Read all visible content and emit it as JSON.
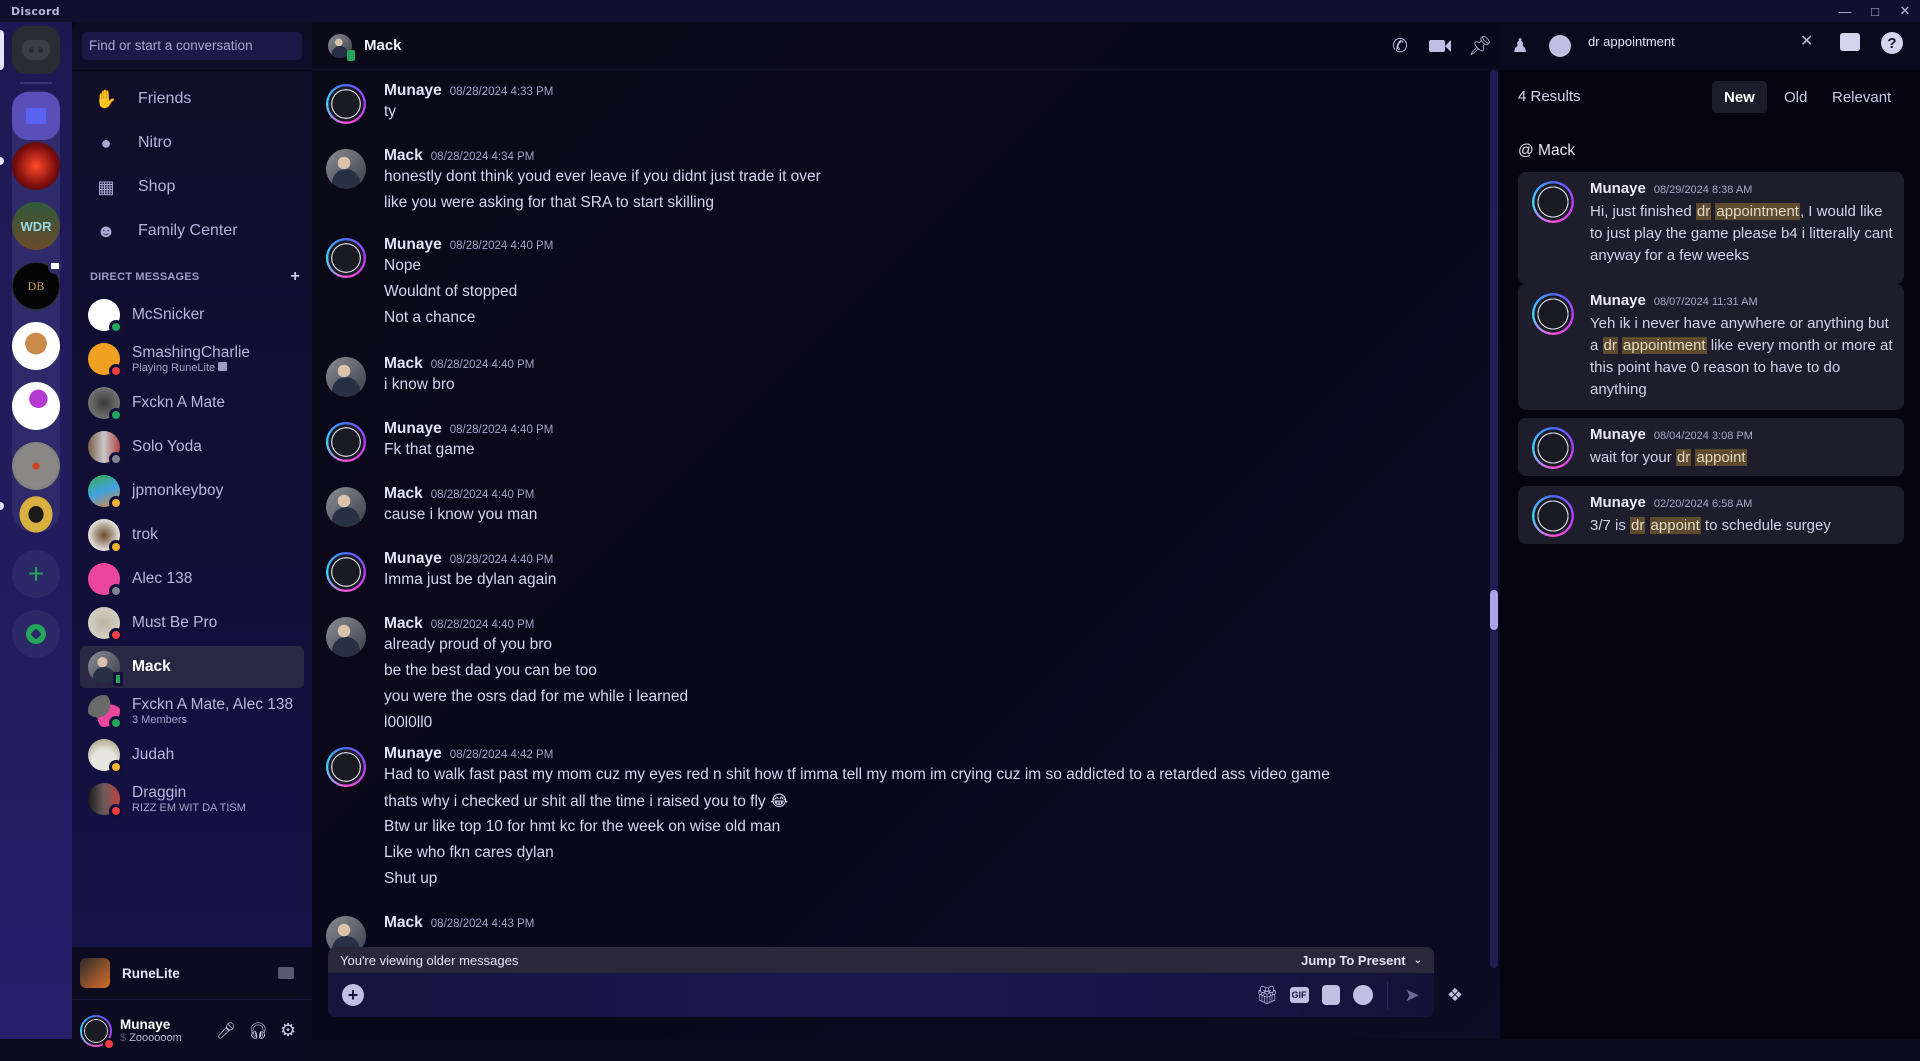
{
  "window": {
    "title": "Discord",
    "controls": [
      "minimize",
      "maximize",
      "close"
    ]
  },
  "servers": [
    {
      "name": "Direct Messages",
      "icon": "discord-logo-icon"
    },
    {
      "name": "Folder",
      "icon": "folder-icon"
    },
    {
      "name": "Server red demon",
      "icon": "server-icon"
    },
    {
      "name": "WDR",
      "icon": "server-icon",
      "label": "WDR"
    },
    {
      "name": "DB",
      "icon": "server-icon",
      "label": "DB"
    },
    {
      "name": "Doge server",
      "icon": "server-icon"
    },
    {
      "name": "Crab server",
      "icon": "server-icon"
    },
    {
      "name": "Rune server",
      "icon": "server-icon"
    },
    {
      "name": "Spartan server",
      "icon": "server-icon"
    },
    {
      "name": "Add a Server",
      "icon": "plus-icon"
    },
    {
      "name": "Discover",
      "icon": "compass-icon"
    }
  ],
  "sidebar": {
    "search_placeholder": "Find or start a conversation",
    "nav": [
      {
        "label": "Friends",
        "icon": "friends-icon"
      },
      {
        "label": "Nitro",
        "icon": "nitro-icon"
      },
      {
        "label": "Shop",
        "icon": "shop-icon"
      },
      {
        "label": "Family Center",
        "icon": "family-icon"
      }
    ],
    "dm_header": "DIRECT MESSAGES",
    "dm_add": "+",
    "dms": [
      {
        "name": "McSnicker",
        "sub": "",
        "status": "online"
      },
      {
        "name": "SmashingCharlie",
        "sub": "Playing RuneLite",
        "status": "dnd"
      },
      {
        "name": "Fxckn A Mate",
        "sub": "",
        "status": "online"
      },
      {
        "name": "Solo Yoda",
        "sub": "",
        "status": "offline"
      },
      {
        "name": "jpmonkeyboy",
        "sub": "",
        "status": "idle"
      },
      {
        "name": "trok",
        "sub": "",
        "status": "idle"
      },
      {
        "name": "Alec 138",
        "sub": "",
        "status": "offline"
      },
      {
        "name": "Must Be Pro",
        "sub": "",
        "status": "dnd"
      },
      {
        "name": "Mack",
        "sub": "",
        "status": "mobile",
        "active": true
      },
      {
        "name": "Fxckn A Mate, Alec 138",
        "sub": "3 Members",
        "status": "group"
      },
      {
        "name": "Judah",
        "sub": "",
        "status": "idle"
      },
      {
        "name": "Draggin",
        "sub": "RIZZ EM WIT DA TISM",
        "status": "dnd"
      }
    ],
    "activity": {
      "game": "RuneLite"
    },
    "user": {
      "name": "Munaye",
      "status_text": "Zoooooom"
    }
  },
  "colors": {
    "online": "#23a55a",
    "dnd": "#f23f43",
    "idle": "#f0b232",
    "offline": "#80848e",
    "accent": "#5865f2",
    "highlight": "#5e4a2c"
  },
  "chat": {
    "recipient": "Mack",
    "messages": [
      {
        "author": "Munaye",
        "timestamp": "08/28/2024 4:33 PM",
        "lines": [
          "ty"
        ]
      },
      {
        "author": "Mack",
        "timestamp": "08/28/2024 4:34 PM",
        "lines": [
          "honestly dont think youd ever leave if you didnt just trade it over",
          "like you were asking for that SRA to start skilling"
        ]
      },
      {
        "author": "Munaye",
        "timestamp": "08/28/2024 4:40 PM",
        "lines": [
          "Nope",
          "Wouldnt of stopped",
          "Not a chance"
        ]
      },
      {
        "author": "Mack",
        "timestamp": "08/28/2024 4:40 PM",
        "lines": [
          "i know bro"
        ]
      },
      {
        "author": "Munaye",
        "timestamp": "08/28/2024 4:40 PM",
        "lines": [
          "Fk that game"
        ]
      },
      {
        "author": "Mack",
        "timestamp": "08/28/2024 4:40 PM",
        "lines": [
          "cause i know you man"
        ]
      },
      {
        "author": "Munaye",
        "timestamp": "08/28/2024 4:40 PM",
        "lines": [
          "Imma just be dylan again"
        ]
      },
      {
        "author": "Mack",
        "timestamp": "08/28/2024 4:40 PM",
        "lines": [
          "already proud of you bro",
          "be the best dad you can be too",
          "you were the osrs dad for me while i learned",
          "l00l0ll0"
        ]
      },
      {
        "author": "Munaye",
        "timestamp": "08/28/2024 4:42 PM",
        "lines": [
          "Had to walk fast past my mom cuz my eyes red n shit how tf imma tell my mom im crying cuz im so addicted to a retarded ass video game",
          "thats why i checked ur shit all the time i raised you to fly 😂",
          "Btw ur like top 10 for hmt kc for the week on wise old man",
          "Like who fkn cares dylan",
          "Shut up"
        ]
      },
      {
        "author": "Mack",
        "timestamp": "08/28/2024 4:43 PM",
        "lines": []
      }
    ],
    "older_notice": "You're viewing older messages",
    "jump_label": "Jump To Present",
    "composer_placeholder": ""
  },
  "header_icons": [
    "voice-call-icon",
    "video-call-icon",
    "pinned-icon",
    "add-friends-icon",
    "user-profile-icon"
  ],
  "search": {
    "query": "dr appointment",
    "results_count": "4 Results",
    "sort": [
      "New",
      "Old",
      "Relevant"
    ],
    "sort_active": "New",
    "context": "@ Mack",
    "results": [
      {
        "author": "Munaye",
        "timestamp": "08/29/2024 8:38 AM",
        "parts": [
          {
            "t": "Hi, just finished "
          },
          {
            "t": "dr",
            "h": true
          },
          {
            "t": " "
          },
          {
            "t": "appointment",
            "h": true
          },
          {
            "t": ", I would like to just play the game please b4 i litterally cant anyway for a few weeks"
          }
        ]
      },
      {
        "author": "Munaye",
        "timestamp": "08/07/2024 11:31 AM",
        "parts": [
          {
            "t": "Yeh ik i never have anywhere or anything but a "
          },
          {
            "t": "dr",
            "h": true
          },
          {
            "t": " "
          },
          {
            "t": "appointment",
            "h": true
          },
          {
            "t": " like every month or more at this point  have 0 reason to have to do anything"
          }
        ]
      },
      {
        "author": "Munaye",
        "timestamp": "08/04/2024 3:08 PM",
        "parts": [
          {
            "t": "wait for your "
          },
          {
            "t": "dr",
            "h": true
          },
          {
            "t": " "
          },
          {
            "t": "appoint",
            "h": true
          }
        ]
      },
      {
        "author": "Munaye",
        "timestamp": "02/20/2024 6:58 AM",
        "parts": [
          {
            "t": "3/7 is "
          },
          {
            "t": "dr",
            "h": true
          },
          {
            "t": " "
          },
          {
            "t": "appoint",
            "h": true
          },
          {
            "t": " to schedule surgey"
          }
        ]
      }
    ]
  }
}
